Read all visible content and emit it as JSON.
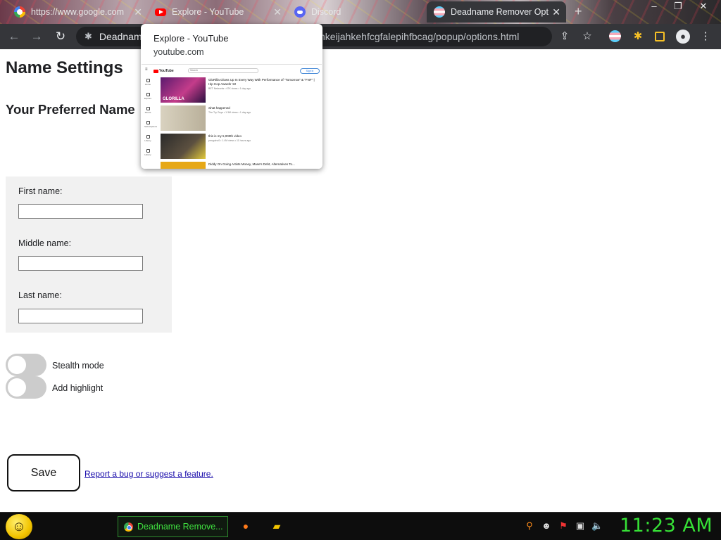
{
  "tabs": [
    {
      "title": "https://www.google.com",
      "icon": "google-icon",
      "active": false
    },
    {
      "title": "Explore - YouTube",
      "icon": "youtube-icon",
      "active": false
    },
    {
      "title": "Discord",
      "icon": "discord-icon",
      "active": false
    },
    {
      "title": "Deadname Remover Opt",
      "icon": "trans-flag-icon",
      "active": true
    }
  ],
  "omnibox": {
    "site_label": "Deadnam",
    "url_tail": "nkeijahkehfcgfalepihfbcag/popup/options.html"
  },
  "preview": {
    "title": "Explore - YouTube",
    "host": "youtube.com",
    "search_placeholder": "Search",
    "sign_in": "Sign in",
    "logo_text": "YouTube",
    "videos": [
      {
        "title": "GloRilla Glows Up In Every Way With Performance of \"Tomorrow\" & \"FNF\" | Hip Hop Awards '22",
        "meta": "BET Networks • 67K views • 1 day ago",
        "thumb_text": "GLORILLA"
      },
      {
        "title": "what happened",
        "meta": "The Try Guys • 1.3M views • 1 day ago"
      },
      {
        "title": "this is my 5,000th video",
        "meta": "penguinz0 • 1.4M views • 11 hours ago"
      },
      {
        "title": "Diddy On Going Artists Money, Mase's Debt, Alternatives To...",
        "meta": ""
      }
    ],
    "sidebar": [
      "Home",
      "Explore",
      "Shorts",
      "Subscriptions",
      "Library",
      "History"
    ]
  },
  "page": {
    "title": "Name Settings",
    "subtitle": "Your Preferred Name",
    "fields": [
      {
        "label": "First name:",
        "placeholder": ""
      },
      {
        "label": "Middle name:",
        "placeholder": ""
      },
      {
        "label": "Last name:",
        "placeholder": ""
      }
    ],
    "toggles": [
      {
        "label": "Stealth mode",
        "on": false
      },
      {
        "label": "Add highlight",
        "on": false
      }
    ],
    "save_label": "Save",
    "report_link": "Report a bug or suggest a feature."
  },
  "taskbar": {
    "task_label": "Deadname Remove...",
    "clock": "11:23 AM"
  },
  "colors": {
    "toolbar_bg": "#35363a",
    "form_panel_bg": "#f1f1f1",
    "toggle_off": "#cccccc",
    "clock_green": "#36e036",
    "link_blue": "#1a0dab"
  }
}
